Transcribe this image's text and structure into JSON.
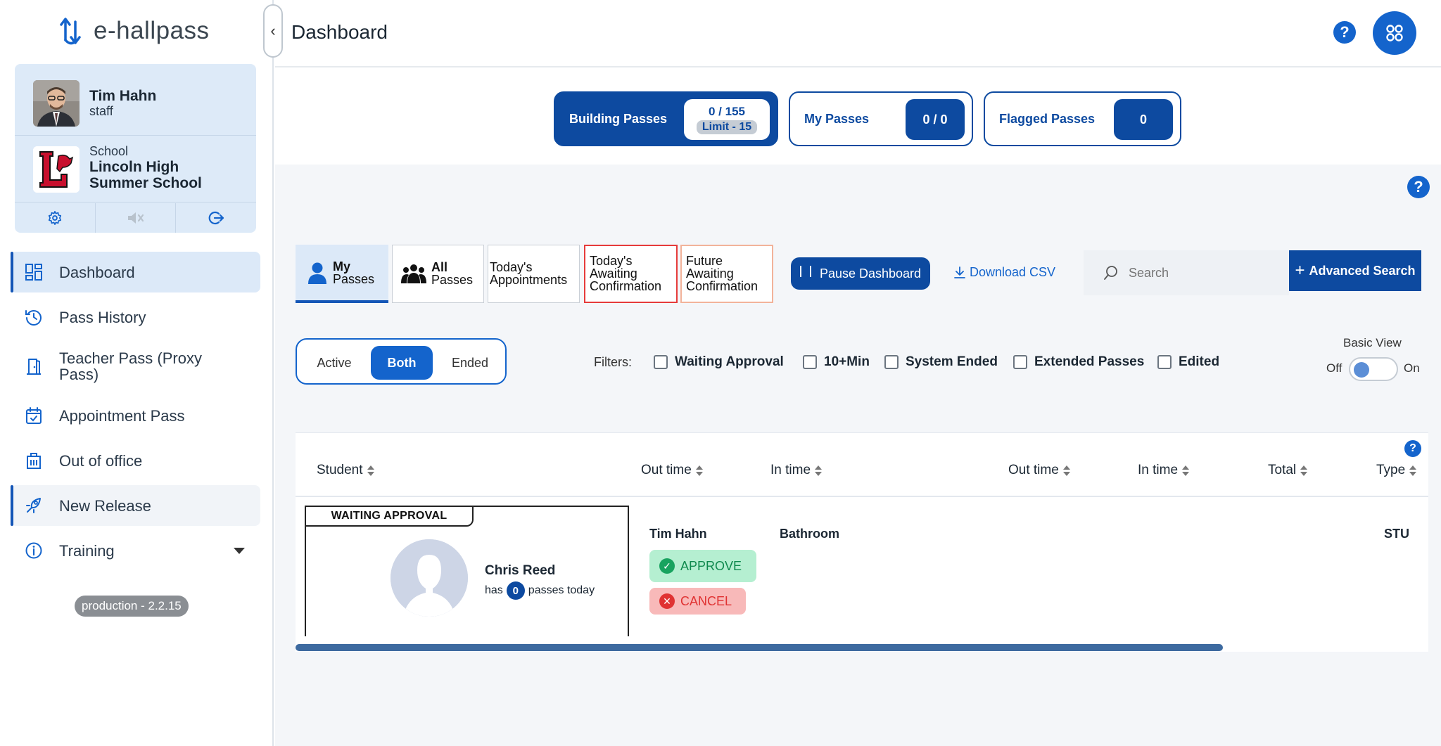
{
  "app": {
    "logo_text": "e-hallpass",
    "collapse_icon": "‹"
  },
  "profile": {
    "name": "Tim Hahn",
    "role": "staff",
    "school_label": "School",
    "school_name": "Lincoln High Summer School"
  },
  "sidebar": {
    "items": [
      {
        "label": "Dashboard",
        "icon": "dashboard-icon"
      },
      {
        "label": "Pass History",
        "icon": "history-icon"
      },
      {
        "label": "Teacher Pass (Proxy Pass)",
        "icon": "door-icon"
      },
      {
        "label": "Appointment Pass",
        "icon": "calendar-icon"
      },
      {
        "label": "Out of office",
        "icon": "building-icon"
      },
      {
        "label": "New Release",
        "icon": "rocket-icon"
      },
      {
        "label": "Training",
        "icon": "info-icon"
      }
    ],
    "version": "production - 2.2.15"
  },
  "header": {
    "title": "Dashboard",
    "help": "?"
  },
  "counters": {
    "building": {
      "label": "Building Passes",
      "value": "0 / 155",
      "limit": "Limit - 15"
    },
    "my": {
      "label": "My Passes",
      "value": "0 / 0"
    },
    "flagged": {
      "label": "Flagged Passes",
      "value": "0"
    }
  },
  "main": {
    "help": "?",
    "tabs": {
      "my": [
        "My",
        "Passes"
      ],
      "all": [
        "All",
        "Passes"
      ],
      "appointments": [
        "Today's",
        "Appointments"
      ],
      "today_awaiting": [
        "Today's",
        "Awaiting",
        "Confirmation"
      ],
      "future_awaiting": [
        "Future",
        "Awaiting",
        "Confirmation"
      ]
    },
    "pause_label": "Pause Dashboard",
    "download_label": "Download CSV",
    "search_placeholder": "Search",
    "advanced_search_label": "Advanced Search",
    "status": {
      "active": "Active",
      "both": "Both",
      "ended": "Ended",
      "selected": "Both"
    },
    "filters_label": "Filters:",
    "filters": [
      "Waiting Approval",
      "10+Min",
      "System Ended",
      "Extended Passes",
      "Edited"
    ],
    "basic_view": {
      "label": "Basic View",
      "off": "Off",
      "on": "On",
      "enabled": false
    }
  },
  "table": {
    "columns": [
      "Student",
      "Out time",
      "In time",
      "Out time",
      "In time",
      "Total",
      "Type"
    ],
    "help": "?",
    "rows": [
      {
        "status_badge": "WAITING APPROVAL",
        "student": "Chris Reed",
        "passes_prefix": "has",
        "pass_count": "0",
        "passes_suffix": "passes today",
        "teacher": "Tim Hahn",
        "destination": "Bathroom",
        "type": "STU",
        "approve_label": "APPROVE",
        "cancel_label": "CANCEL"
      }
    ]
  },
  "colors": {
    "brand_blue": "#0d4aa0",
    "accent_blue": "#1464cc",
    "approve_green": "#18a35f",
    "cancel_red": "#e03232"
  }
}
